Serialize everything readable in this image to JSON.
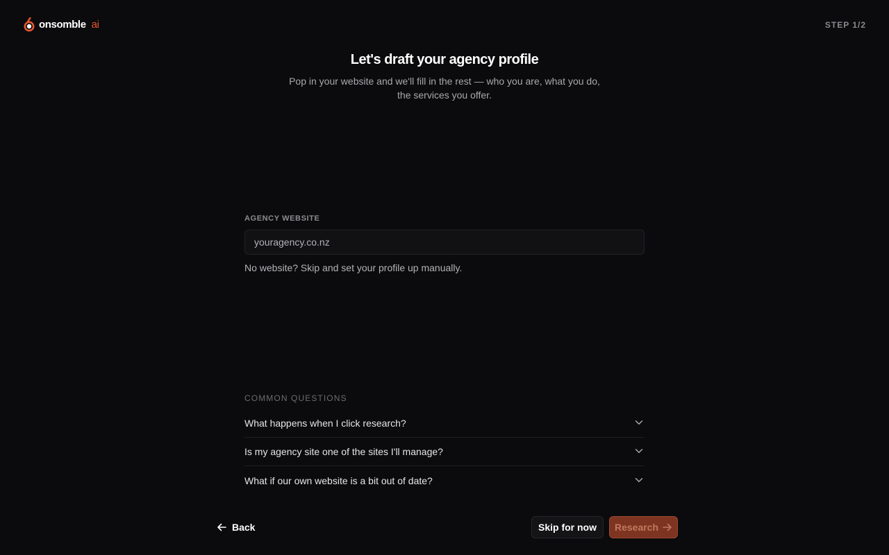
{
  "brand": {
    "name": "onsomble",
    "suffix": "ai",
    "accent_color": "#e8552d",
    "logo_icon": "onsomble-logo-icon"
  },
  "header": {
    "step": "STEP 1/2"
  },
  "hero": {
    "title": "Let's draft your agency profile",
    "subtitle": "Pop in your website and we'll fill in the rest — who you are, what you do, the services you offer."
  },
  "form": {
    "website_label": "AGENCY WEBSITE",
    "website_value": "",
    "website_placeholder": "youragency.co.nz",
    "hint": "No website? Skip and set your profile up manually."
  },
  "faq": {
    "heading": "COMMON QUESTIONS",
    "items": [
      {
        "question": "What happens when I click research?",
        "icon": "chevron-down-icon"
      },
      {
        "question": "Is my agency site one of the sites I'll manage?",
        "icon": "chevron-down-icon"
      },
      {
        "question": "What if our own website is a bit out of date?",
        "icon": "chevron-down-icon"
      }
    ]
  },
  "footer": {
    "back_label": "Back",
    "back_icon": "arrow-left-icon",
    "skip_label": "Skip for now",
    "research_label": "Research",
    "research_icon": "arrow-right-icon",
    "research_color": "#7d3420"
  }
}
